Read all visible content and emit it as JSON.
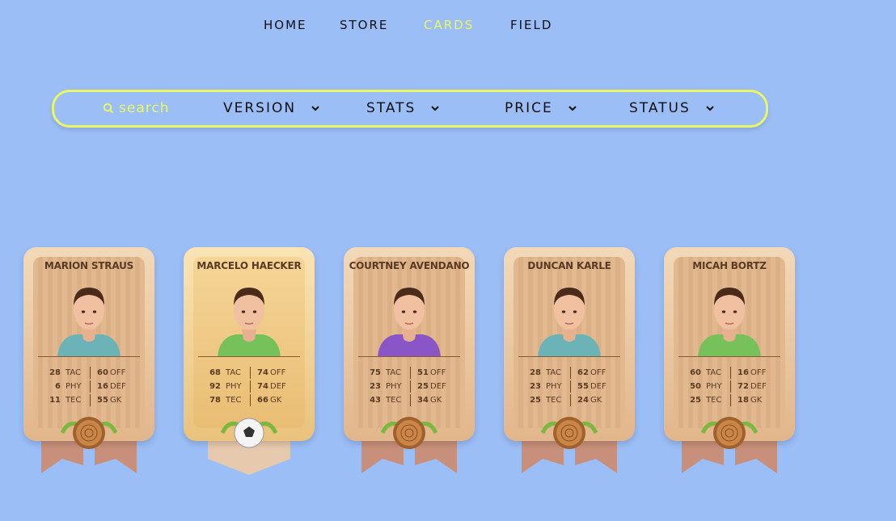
{
  "nav": {
    "items": [
      {
        "label": "HOME",
        "active": false
      },
      {
        "label": "STORE",
        "active": false
      },
      {
        "label": "CARDS",
        "active": true
      },
      {
        "label": "FIELD",
        "active": false
      }
    ]
  },
  "filters": {
    "search_placeholder": "search",
    "dropdowns": [
      {
        "label": "VERSION"
      },
      {
        "label": "STATS"
      },
      {
        "label": "PRICE"
      },
      {
        "label": "STATUS"
      }
    ]
  },
  "colors": {
    "background": "#9cbef7",
    "accent": "#e9f763"
  },
  "cards": [
    {
      "name": "MARION STRAUS",
      "shirt": "#6bb3b7",
      "style": "wood",
      "stats": [
        [
          "28",
          "TAC",
          "60",
          "OFF"
        ],
        [
          "6",
          "PHY",
          "16",
          "DEF"
        ],
        [
          "11",
          "TEC",
          "55",
          "GK"
        ]
      ]
    },
    {
      "name": "MARCELO HAECKER",
      "shirt": "#77c15a",
      "style": "gold",
      "stats": [
        [
          "68",
          "TAC",
          "74",
          "OFF"
        ],
        [
          "92",
          "PHY",
          "74",
          "DEF"
        ],
        [
          "78",
          "TEC",
          "66",
          "GK"
        ]
      ]
    },
    {
      "name": "COURTNEY AVENDANO",
      "shirt": "#8a56c7",
      "style": "wood",
      "stats": [
        [
          "75",
          "TAC",
          "51",
          "OFF"
        ],
        [
          "23",
          "PHY",
          "25",
          "DEF"
        ],
        [
          "43",
          "TEC",
          "34",
          "GK"
        ]
      ]
    },
    {
      "name": "DUNCAN KARLE",
      "shirt": "#6bb3b7",
      "style": "wood",
      "stats": [
        [
          "28",
          "TAC",
          "62",
          "OFF"
        ],
        [
          "23",
          "PHY",
          "55",
          "DEF"
        ],
        [
          "25",
          "TEC",
          "24",
          "GK"
        ]
      ]
    },
    {
      "name": "MICAH BORTZ",
      "shirt": "#77c15a",
      "style": "wood",
      "stats": [
        [
          "60",
          "TAC",
          "16",
          "OFF"
        ],
        [
          "50",
          "PHY",
          "72",
          "DEF"
        ],
        [
          "25",
          "TEC",
          "18",
          "GK"
        ]
      ]
    }
  ]
}
